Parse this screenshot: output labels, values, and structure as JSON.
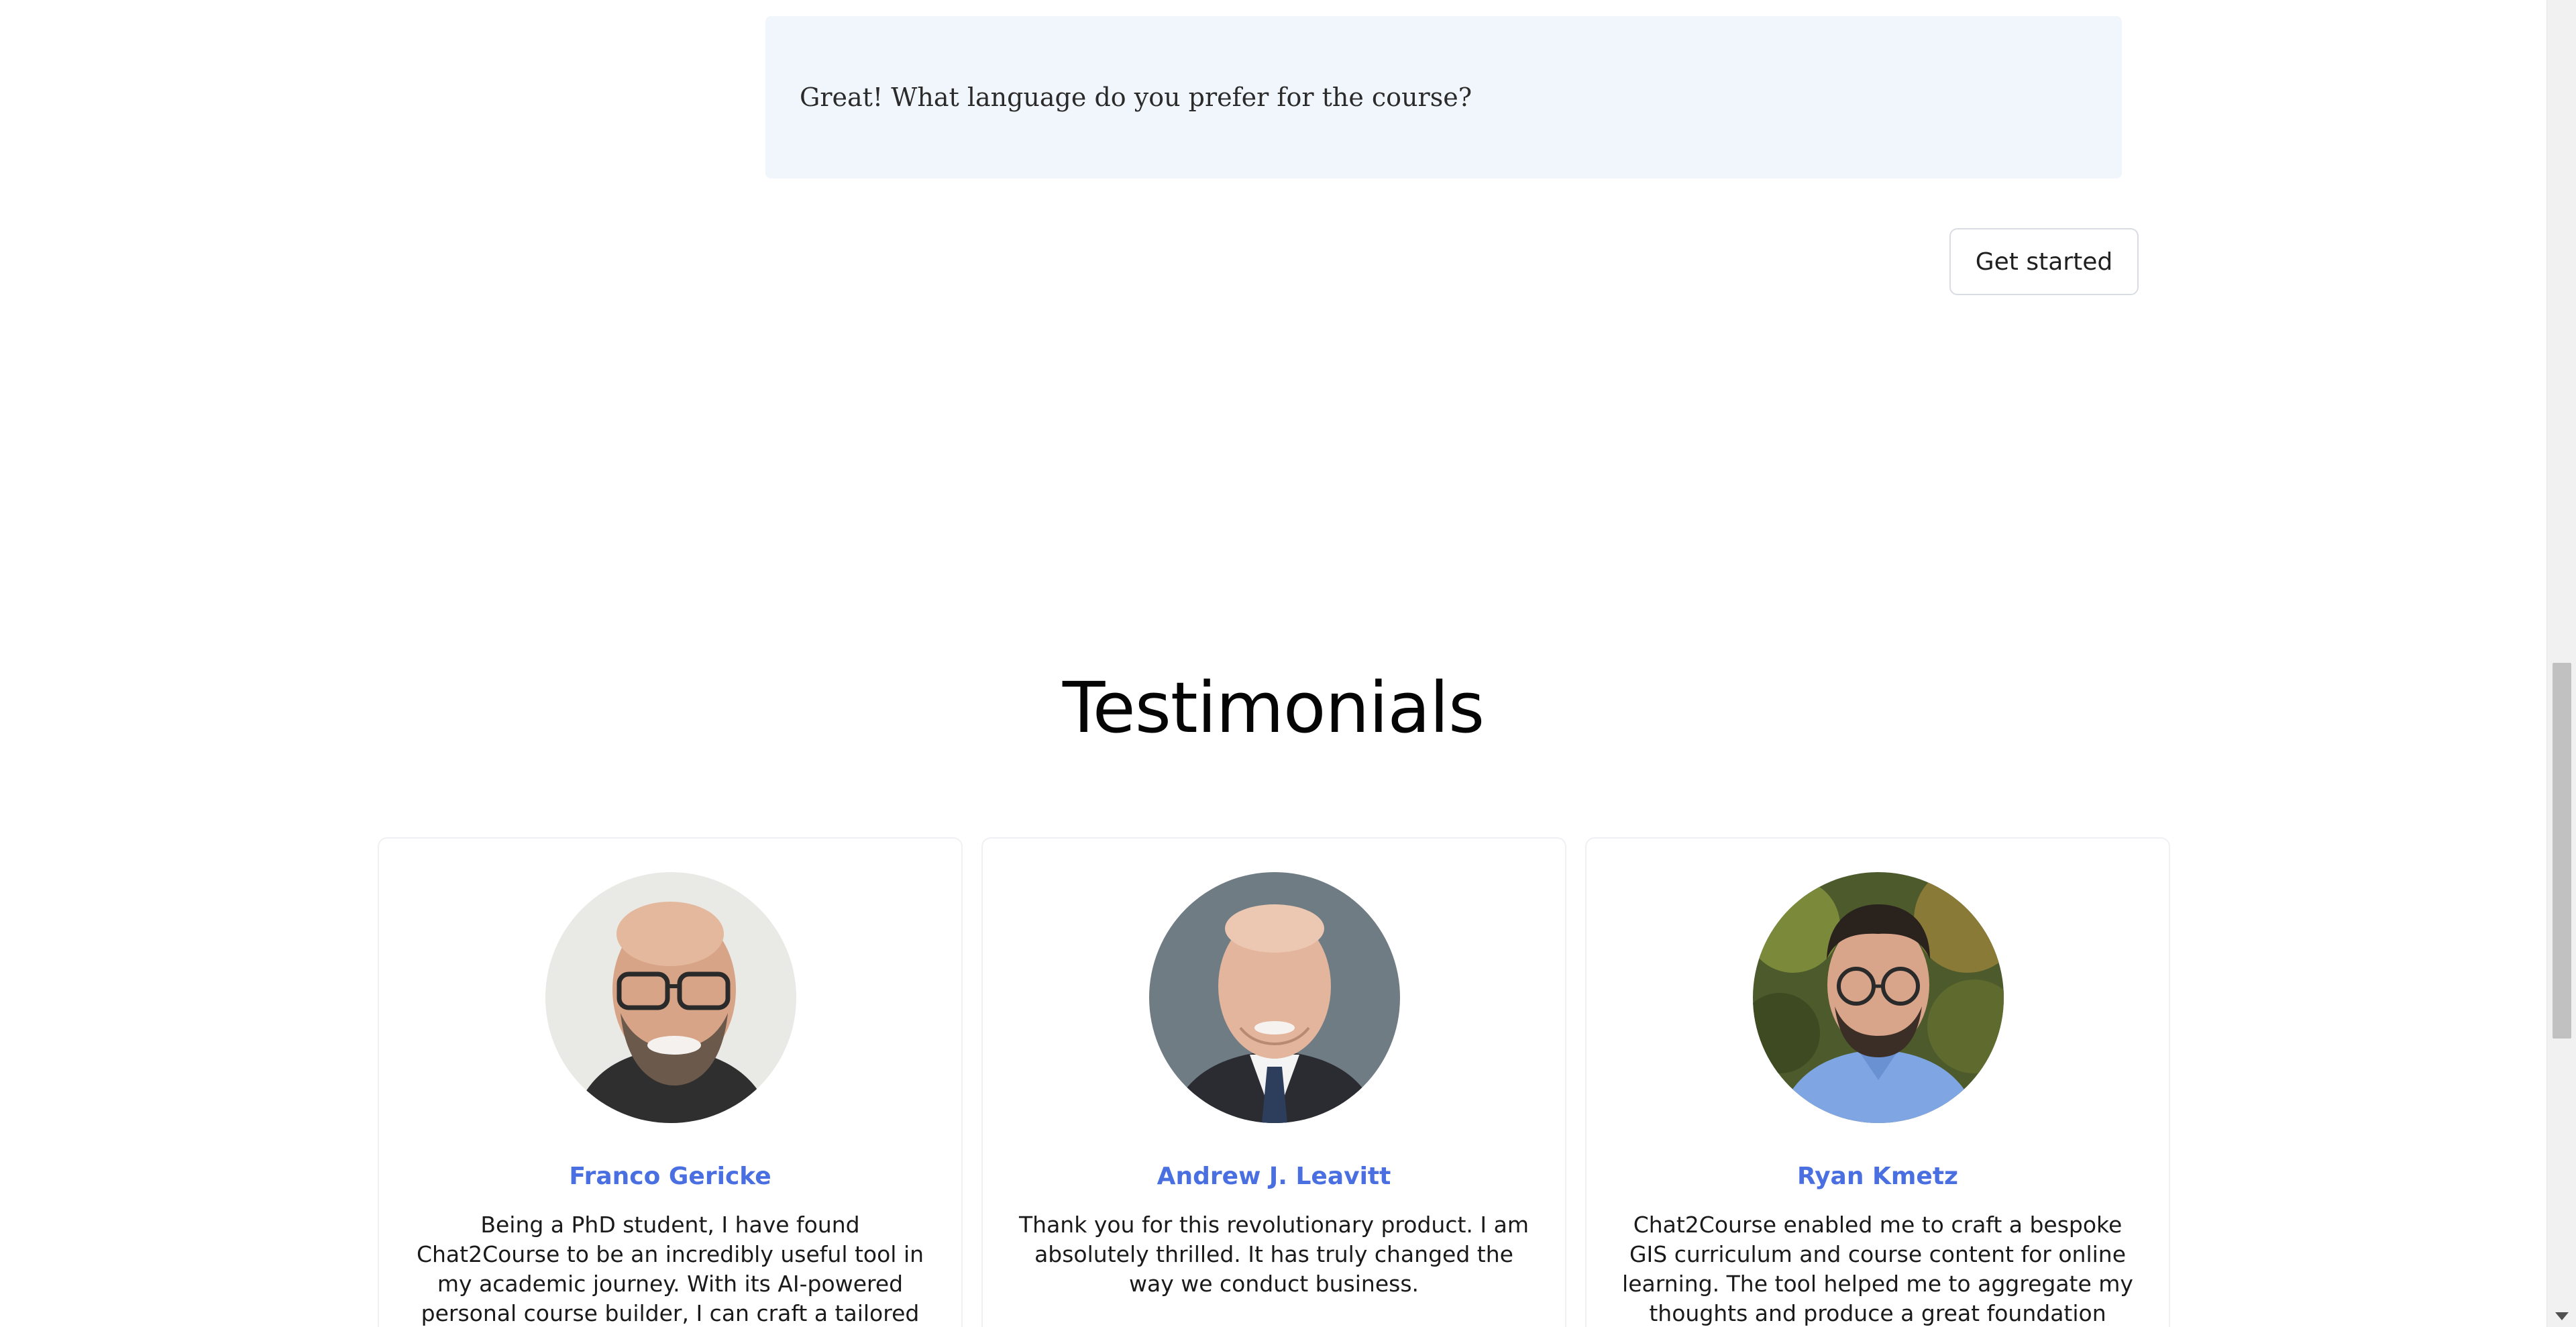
{
  "chat": {
    "message": "Great! What language do you prefer for the course?"
  },
  "cta": {
    "get_started_label": "Get started"
  },
  "testimonials": {
    "title": "Testimonials",
    "accent_color": "#4a6fe0",
    "items": [
      {
        "name": "Franco Gericke",
        "quote": "Being a PhD student, I have found Chat2Course to be an incredibly useful tool in my academic journey. With its AI-powered personal course builder, I can craft a tailored"
      },
      {
        "name": "Andrew J. Leavitt",
        "quote": "Thank you for this revolutionary product. I am absolutely thrilled. It has truly changed the way we conduct business."
      },
      {
        "name": "Ryan Kmetz",
        "quote": "Chat2Course enabled me to craft a bespoke GIS curriculum and course content for online learning. The tool helped me to aggregate my thoughts and produce a great foundation"
      }
    ]
  }
}
